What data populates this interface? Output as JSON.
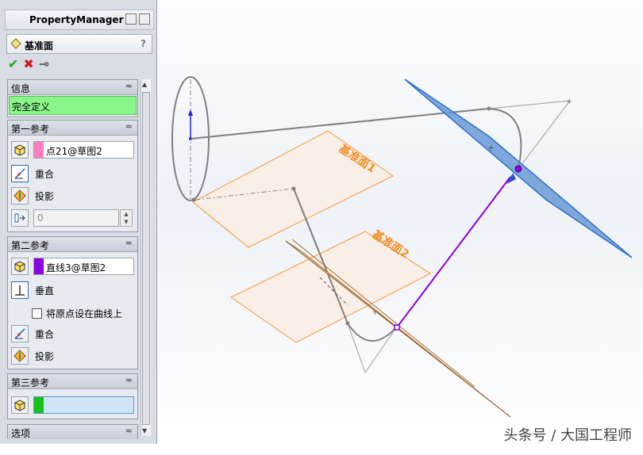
{
  "panel": {
    "title": "PropertyManager"
  },
  "feature": {
    "title": "基准面",
    "help": "?"
  },
  "actions": {
    "ok_glyph": "✔",
    "cancel_glyph": "✖",
    "pin_glyph": "⊸"
  },
  "info": {
    "header": "信息",
    "status": "完全定义",
    "status_color": "#8af58a"
  },
  "ref1": {
    "header": "第一参考",
    "entity": "点21@草图2",
    "entity_color": "#ff80c0",
    "option1": "重合",
    "option2": "投影",
    "value": "0"
  },
  "ref2": {
    "header": "第二参考",
    "entity": "直线3@草图2",
    "entity_color": "#8a00e0",
    "option1": "垂直",
    "checkbox_label": "将原点设在曲线上",
    "option2": "重合",
    "option3": "投影"
  },
  "ref3": {
    "header": "第三参考",
    "entity": "",
    "entity_color": "#18c018"
  },
  "options": {
    "header": "选项"
  },
  "chevron": "≈",
  "viewport": {
    "plane1_label": "基准面1",
    "plane2_label": "基准面2",
    "watermark": "头条号 / 大国工程师"
  }
}
